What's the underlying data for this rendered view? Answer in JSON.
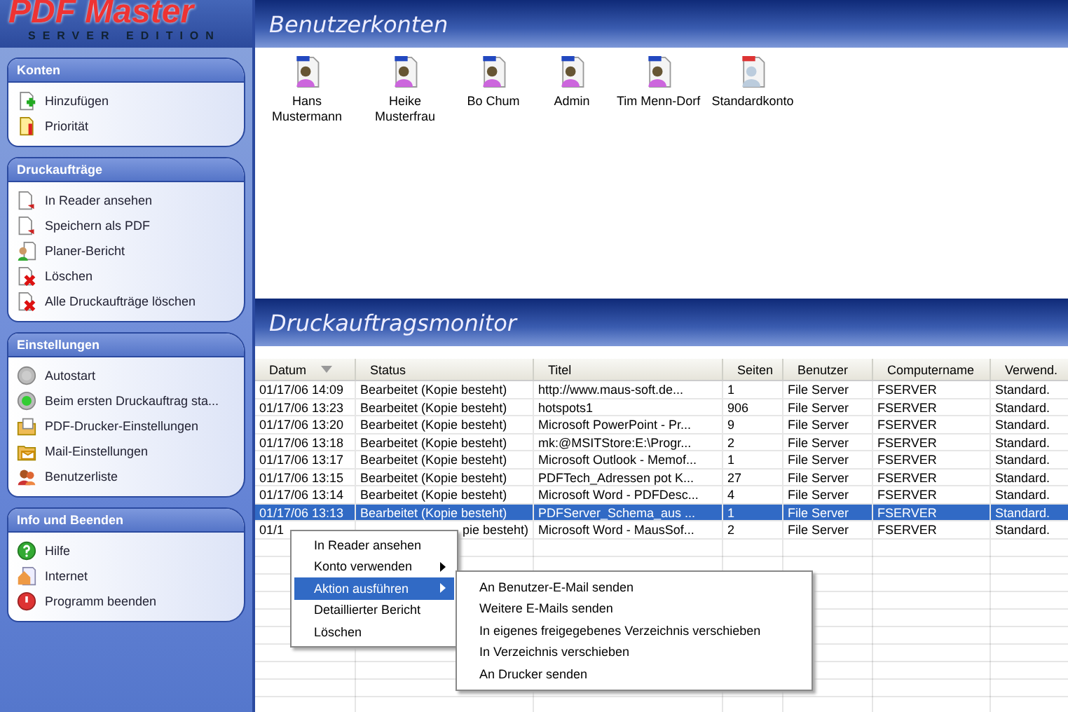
{
  "logo": {
    "title": "PDF Master",
    "subtitle": "SERVER EDITION"
  },
  "sidebar": [
    {
      "title": "Konten",
      "items": [
        {
          "label": "Hinzufügen",
          "kind": "add"
        },
        {
          "label": "Priorität",
          "kind": "priority"
        }
      ]
    },
    {
      "title": "Druckaufträge",
      "items": [
        {
          "label": "In Reader ansehen",
          "kind": "doc"
        },
        {
          "label": "Speichern als PDF",
          "kind": "doc"
        },
        {
          "label": "Planer-Bericht",
          "kind": "person"
        },
        {
          "label": "Löschen",
          "kind": "delete"
        },
        {
          "label": "Alle Druckaufträge löschen",
          "kind": "delete"
        }
      ]
    },
    {
      "title": "Einstellungen",
      "items": [
        {
          "label": "Autostart",
          "kind": "radio",
          "selected": false
        },
        {
          "label": "Beim ersten Druckauftrag sta...",
          "kind": "radio",
          "selected": true
        },
        {
          "label": "PDF-Drucker-Einstellungen",
          "kind": "folder"
        },
        {
          "label": "Mail-Einstellungen",
          "kind": "mail"
        },
        {
          "label": "Benutzerliste",
          "kind": "users"
        }
      ]
    },
    {
      "title": "Info und Beenden",
      "items": [
        {
          "label": "Hilfe",
          "kind": "help"
        },
        {
          "label": "Internet",
          "kind": "web"
        },
        {
          "label": "Programm beenden",
          "kind": "exit"
        }
      ]
    }
  ],
  "accounts_panel": {
    "title": "Benutzerkonten",
    "accounts": [
      {
        "name": "Hans Mustermann",
        "kind": "user"
      },
      {
        "name": "Heike Musterfrau",
        "kind": "user"
      },
      {
        "name": "Bo Chum",
        "kind": "user"
      },
      {
        "name": "Admin",
        "kind": "user"
      },
      {
        "name": "Tim Menn-Dorf",
        "kind": "user"
      },
      {
        "name": "Standardkonto",
        "kind": "default"
      }
    ]
  },
  "monitor": {
    "title": "Druckauftragsmonitor",
    "columns": [
      "Datum",
      "Status",
      "Titel",
      "Seiten",
      "Benutzer",
      "Computername",
      "Verwend."
    ],
    "rows": [
      {
        "cells": [
          "01/17/06 14:09",
          "Bearbeitet (Kopie besteht)",
          "http://www.maus-soft.de...",
          "1",
          "File Server",
          "FSERVER",
          "Standard."
        ],
        "selected": false,
        "covered": false
      },
      {
        "cells": [
          "01/17/06 13:23",
          "Bearbeitet (Kopie besteht)",
          "hotspots1",
          "906",
          "File Server",
          "FSERVER",
          "Standard."
        ],
        "selected": false,
        "covered": false
      },
      {
        "cells": [
          "01/17/06 13:20",
          "Bearbeitet (Kopie besteht)",
          "Microsoft PowerPoint - Pr...",
          "9",
          "File Server",
          "FSERVER",
          "Standard."
        ],
        "selected": false,
        "covered": false
      },
      {
        "cells": [
          "01/17/06 13:18",
          "Bearbeitet (Kopie besteht)",
          "mk:@MSITStore:E:\\Progr...",
          "2",
          "File Server",
          "FSERVER",
          "Standard."
        ],
        "selected": false,
        "covered": false
      },
      {
        "cells": [
          "01/17/06 13:17",
          "Bearbeitet (Kopie besteht)",
          "Microsoft Outlook - Memof...",
          "1",
          "File Server",
          "FSERVER",
          "Standard."
        ],
        "selected": false,
        "covered": false
      },
      {
        "cells": [
          "01/17/06 13:15",
          "Bearbeitet (Kopie besteht)",
          "PDFTech_Adressen pot K...",
          "27",
          "File Server",
          "FSERVER",
          "Standard."
        ],
        "selected": false,
        "covered": false
      },
      {
        "cells": [
          "01/17/06 13:14",
          "Bearbeitet (Kopie besteht)",
          "Microsoft Word - PDFDesc...",
          "4",
          "File Server",
          "FSERVER",
          "Standard."
        ],
        "selected": false,
        "covered": false
      },
      {
        "cells": [
          "01/17/06 13:13",
          "Bearbeitet (Kopie besteht)",
          "PDFServer_Schema_aus ...",
          "1",
          "File Server",
          "FSERVER",
          "Standard."
        ],
        "selected": true,
        "covered": false
      },
      {
        "cells": [
          "01/1",
          "pie besteht)",
          "Microsoft Word - MausSof...",
          "2",
          "File Server",
          "FSERVER",
          "Standard."
        ],
        "selected": false,
        "covered": true
      }
    ]
  },
  "context_menu": {
    "items": [
      {
        "label": "In Reader ansehen",
        "submenu": false,
        "selected": false
      },
      {
        "label": "Konto verwenden",
        "submenu": true,
        "selected": false
      },
      {
        "label": "Aktion ausführen",
        "submenu": true,
        "selected": true
      },
      {
        "label": "Detaillierter Bericht",
        "submenu": false,
        "selected": false
      },
      {
        "label": "Löschen",
        "submenu": false,
        "selected": false
      }
    ],
    "submenu_items": [
      "An Benutzer-E-Mail senden",
      "Weitere E-Mails senden",
      "In eigenes freigegebenes Verzeichnis verschieben",
      "In Verzeichnis verschieben",
      "An Drucker senden"
    ]
  }
}
